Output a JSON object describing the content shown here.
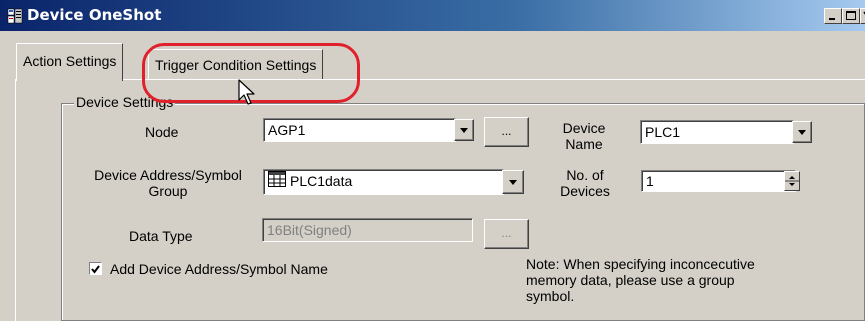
{
  "window": {
    "title": "Device OneShot",
    "icon": "app-icon",
    "controls": [
      "minimize-icon",
      "maximize-icon",
      "close-icon"
    ]
  },
  "tabs": [
    {
      "label": "Action Settings",
      "selected": true
    },
    {
      "label": "Trigger Condition Settings",
      "selected": false
    }
  ],
  "group": {
    "label": "Device Settings"
  },
  "node": {
    "label": "Node",
    "value": "AGP1",
    "browse_label": "..."
  },
  "device_name": {
    "label_line1": "Device",
    "label_line2": "Name",
    "value": "PLC1"
  },
  "device_address": {
    "label_line1": "Device Address/Symbol",
    "label_line2": "Group",
    "value": "PLC1data",
    "icon": "symbol-group-icon"
  },
  "num_devices": {
    "label_line1": "No. of",
    "label_line2": "Devices",
    "value": "1"
  },
  "data_type": {
    "label": "Data Type",
    "value": "16Bit(Signed)",
    "browse_label": "..."
  },
  "add_symbol": {
    "label": "Add Device Address/Symbol Name",
    "checked": true
  },
  "note": {
    "line1": "Note: When specifying inconcecutive",
    "line2": "memory data, please use a group",
    "line3": "symbol."
  },
  "colors": {
    "titlebar_start": "#0a246a",
    "titlebar_end": "#a6caf0",
    "highlight": "#e0202a",
    "face": "#d4d0c8"
  }
}
